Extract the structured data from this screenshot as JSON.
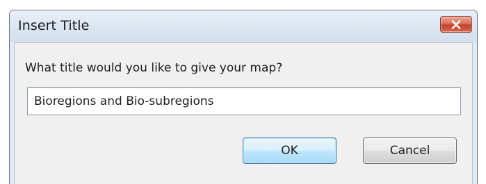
{
  "window": {
    "title": "Insert Title",
    "close_icon": "close-icon"
  },
  "dialog": {
    "prompt": "What title would you like to give your map?",
    "input_value": "Bioregions and Bio-subregions",
    "ok_label": "OK",
    "cancel_label": "Cancel"
  },
  "colors": {
    "close_button": "#c6412a",
    "ok_button_border": "#3c7fb1",
    "titlebar": "#dbe5f1",
    "client_background": "#f0f0f0"
  }
}
